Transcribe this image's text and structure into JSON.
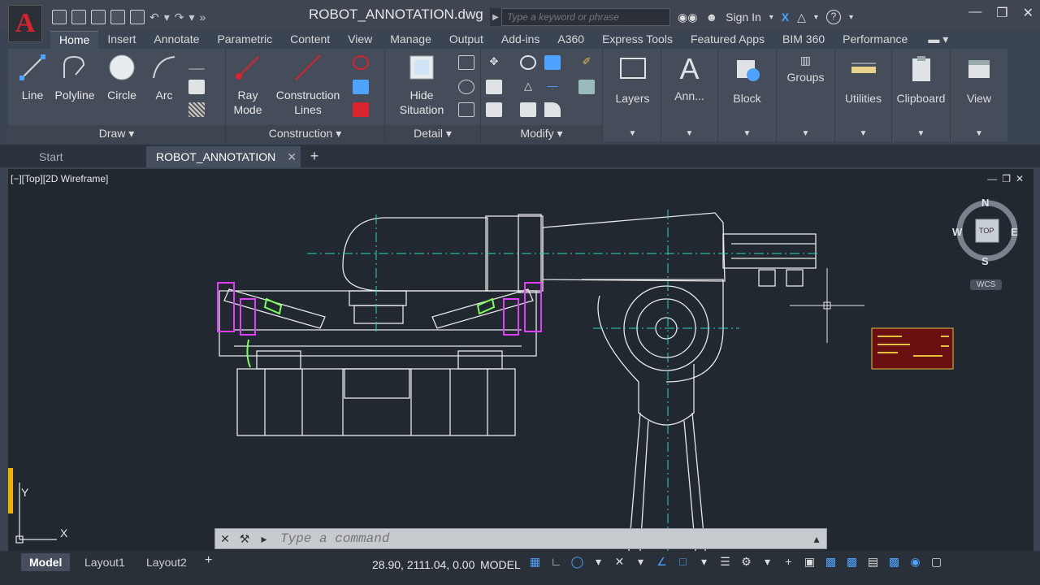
{
  "app": {
    "logo_letter": "A",
    "document_title": "ROBOT_ANNOTATION.dwg",
    "search_placeholder": "Type a keyword or phrase",
    "sign_in_label": "Sign In"
  },
  "ribbon_tabs": [
    "Home",
    "Insert",
    "Annotate",
    "Parametric",
    "Content",
    "View",
    "Manage",
    "Output",
    "Add-ins",
    "A360",
    "Express Tools",
    "Featured Apps",
    "BIM 360",
    "Performance"
  ],
  "ribbon": {
    "draw": {
      "title": "Draw",
      "line": "Line",
      "polyline": "Polyline",
      "circle": "Circle",
      "arc": "Arc"
    },
    "construction": {
      "title": "Construction",
      "ray_mode": "Ray\nMode",
      "construction_lines": "Construction\nLines"
    },
    "detail": {
      "title": "Detail",
      "hide_situation": "Hide\nSituation"
    },
    "modify": {
      "title": "Modify"
    },
    "layers": "Layers",
    "annotation": "Ann...",
    "block": "Block",
    "groups": "Groups",
    "utilities": "Utilities",
    "clipboard": "Clipboard",
    "view": "View"
  },
  "doc_tabs": {
    "start": "Start",
    "active": "ROBOT_ANNOTATION"
  },
  "viewport": {
    "label": "[−][Top][2D Wireframe]",
    "viewcube": {
      "top": "TOP",
      "north": "N",
      "south": "S",
      "east": "E",
      "west": "W",
      "wcs": "WCS"
    },
    "ucs": {
      "x": "X",
      "y": "Y"
    }
  },
  "command": {
    "placeholder": "Type a command"
  },
  "status": {
    "tabs": [
      "Model",
      "Layout1",
      "Layout2"
    ],
    "coords": "28.90, 2111.04, 0.00",
    "mode": "MODEL"
  },
  "colors": {
    "background": "#212830",
    "linework": "#e8e8e8",
    "centerline": "#2dd4bf",
    "magenta": "#e040fb",
    "green": "#7cff5a",
    "accent_blue": "#4da3ff"
  }
}
